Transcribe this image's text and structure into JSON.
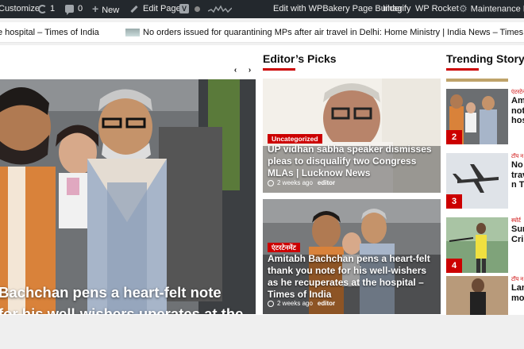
{
  "adminbar": {
    "customize": "Customize",
    "updates_count": "1",
    "comments_count": "0",
    "new_label": "New",
    "edit_page": "Edit Page",
    "wp_icon_letter": "V",
    "wpbakery": "Edit with WPBakery Page Builder",
    "imagify": "Imagify",
    "wp_rocket": "WP Rocket",
    "maintenance": "Maintenance M"
  },
  "ticker": {
    "items": [
      "e hospital – Times of India",
      "No orders issued for quarantining MPs after air travel in Delhi: Home Ministry | India News – Times of Ind"
    ]
  },
  "slider": {
    "prev_icon": "‹",
    "next_icon": "›",
    "title": "Bachchan pens a heart-felt note for his well-wishers uperates at the hospital – ndia"
  },
  "editors_picks": {
    "heading": "Editor’s Picks",
    "cards": [
      {
        "category": "Uncategorized",
        "title": "UP vidhan sabha speaker dismisses pleas to disqualify two Congress MLAs | Lucknow News",
        "time": "2 weeks ago",
        "author": "editor"
      },
      {
        "category": "एंटरटेनमेंट",
        "title": "Amitabh Bachchan pens a heart-felt thank you note for his well-wishers as he recuperates at the hospital – Times of India",
        "time": "2 weeks ago",
        "author": "editor"
      }
    ]
  },
  "trending": {
    "heading": "Trending Story",
    "items": [
      {
        "num": "2",
        "category": "एंटरटेन",
        "title": "Am a h not as hos"
      },
      {
        "num": "3",
        "category": "टॉप न",
        "title": "No qua trav Min Tim"
      },
      {
        "num": "4",
        "category": "स्पोर्ट",
        "title": "Sur Par Cri Ind"
      },
      {
        "num": "",
        "category": "टॉप न",
        "title": "Lar sho mo"
      }
    ]
  },
  "colors": {
    "accent": "#cc0000",
    "adminbar_bg": "#23282d"
  }
}
